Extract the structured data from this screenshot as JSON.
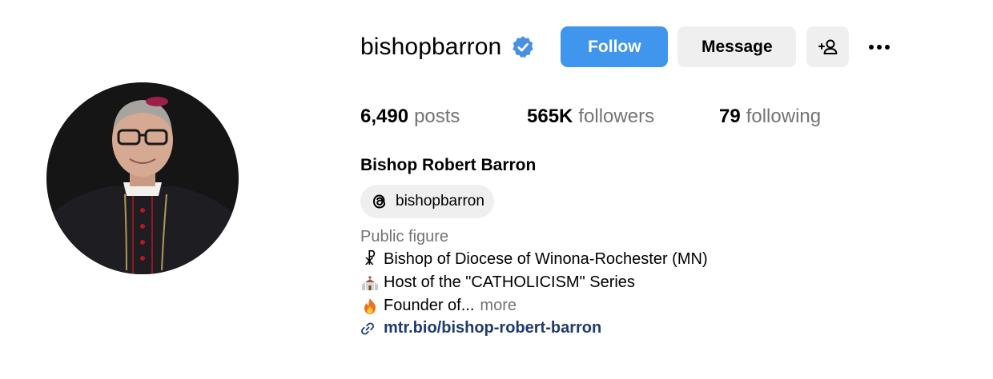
{
  "profile": {
    "username": "bishopbarron",
    "verified": true,
    "full_name": "Bishop Robert Barron",
    "avatar_icon": "profile-photo"
  },
  "actions": {
    "follow_label": "Follow",
    "message_label": "Message",
    "suggest_icon": "add-person-icon",
    "more_icon": "more-options-icon"
  },
  "stats": {
    "posts": {
      "value": "6,490",
      "label": "posts"
    },
    "followers": {
      "value": "565K",
      "label": "followers"
    },
    "following": {
      "value": "79",
      "label": "following"
    }
  },
  "threads": {
    "icon": "threads-icon",
    "handle": "bishopbarron"
  },
  "bio": {
    "category": "Public figure",
    "line1": {
      "emoji": "☧",
      "text": "Bishop of Diocese of Winona-Rochester (MN)"
    },
    "line2": {
      "emoji": "⛪",
      "text": "Host of the \"CATHOLICISM\" Series"
    },
    "line3": {
      "emoji": "🔥",
      "text": "Founder of...",
      "more": "more"
    },
    "link": {
      "icon": "link-icon",
      "text": "mtr.bio/bishop-robert-barron"
    }
  },
  "colors": {
    "follow_blue": "#4095ec",
    "verified_blue": "#4a90e2",
    "secondary_text": "#737373",
    "link_text": "#1f3a6e",
    "button_gray": "#efefef"
  }
}
